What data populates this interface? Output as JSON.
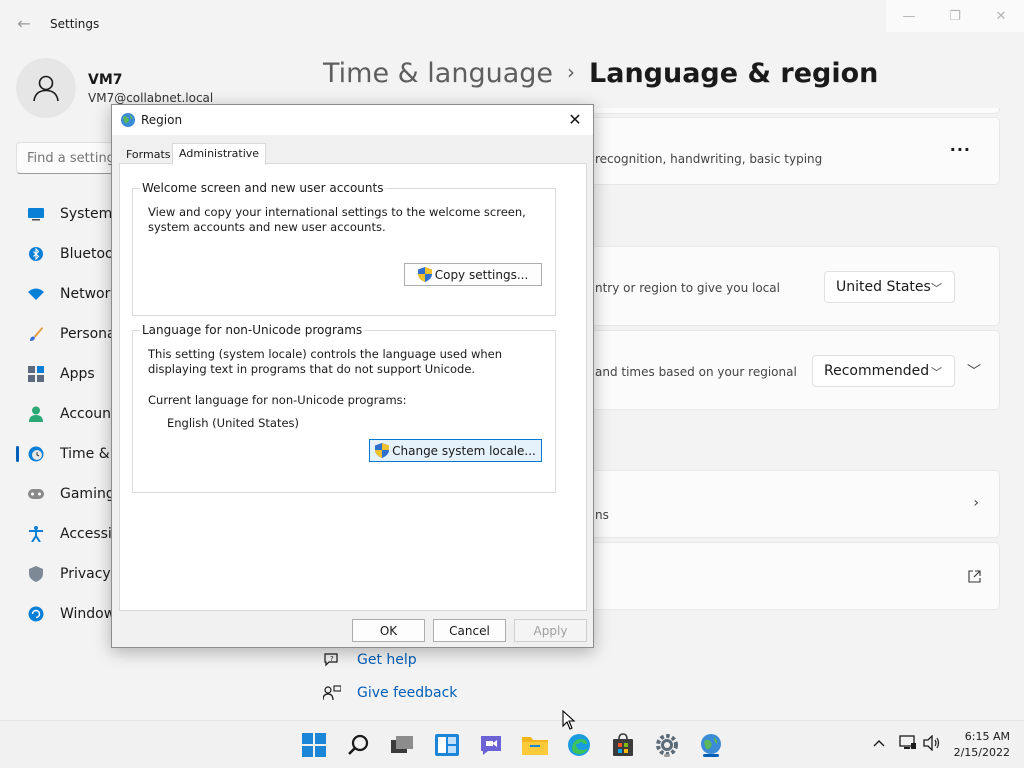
{
  "window": {
    "title": "Settings",
    "minimize_glyph": "—",
    "restore_glyph": "❐",
    "close_glyph": "✕"
  },
  "profile": {
    "name": "VM7",
    "email": "VM7@collabnet.local"
  },
  "search": {
    "placeholder": "Find a setting"
  },
  "sidebar": {
    "items": [
      {
        "label": "System",
        "icon": "monitor-icon"
      },
      {
        "label": "Bluetoot",
        "icon": "bluetooth-icon"
      },
      {
        "label": "Network",
        "icon": "wifi-icon"
      },
      {
        "label": "Personal",
        "icon": "brush-icon"
      },
      {
        "label": "Apps",
        "icon": "apps-icon"
      },
      {
        "label": "Accoun",
        "icon": "person-icon"
      },
      {
        "label": "Time & l",
        "icon": "clock-globe-icon",
        "active": true
      },
      {
        "label": "Gaming",
        "icon": "gamepad-icon"
      },
      {
        "label": "Accessib",
        "icon": "accessibility-icon"
      },
      {
        "label": "Privacy &",
        "icon": "shield-icon"
      },
      {
        "label": "Window",
        "icon": "windows-update-icon"
      }
    ]
  },
  "breadcrumb": {
    "parent": "Time & language",
    "separator": "›",
    "current": "Language & region"
  },
  "cards": {
    "card1_text": "recognition, handwriting, basic typing",
    "card2_text": "ntry or region to give you local",
    "card2_value": "United States",
    "card3_text": "and times based on your regional",
    "card3_value": "Recommended",
    "card4_text": "ns"
  },
  "help": {
    "get_help": "Get help",
    "give_feedback": "Give feedback"
  },
  "dialog": {
    "title": "Region",
    "tabs": [
      "Formats",
      "Administrative"
    ],
    "active_tab": "Administrative",
    "welcome_group": {
      "legend": "Welcome screen and new user accounts",
      "description": "View and copy your international settings to the welcome screen, system accounts and new user accounts.",
      "button": "Copy settings..."
    },
    "unicode_group": {
      "legend": "Language for non-Unicode programs",
      "description": "This setting (system locale) controls the language used when displaying text in programs that do not support Unicode.",
      "current_label": "Current language for non-Unicode programs:",
      "current_value": "English (United States)",
      "button": "Change system locale..."
    },
    "ok": "OK",
    "cancel": "Cancel",
    "apply": "Apply"
  },
  "taskbar": {
    "time": "6:15 AM",
    "date": "2/15/2022"
  },
  "colors": {
    "accent": "#005fb8",
    "focus": "#0078d4"
  }
}
